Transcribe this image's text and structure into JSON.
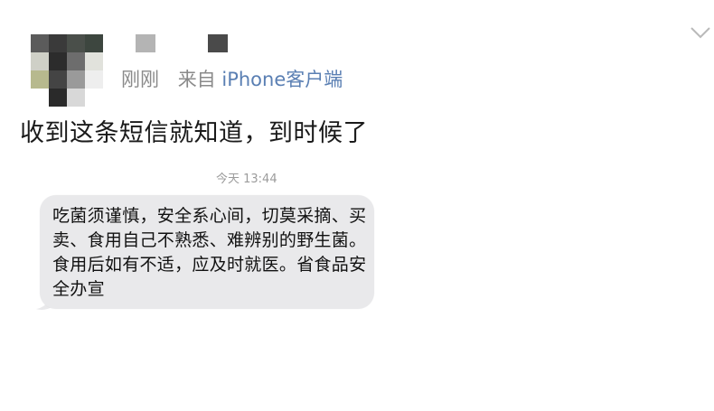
{
  "post": {
    "time": "刚刚",
    "source_prefix": "来自",
    "source": "iPhone客户端",
    "text": "收到这条短信就知道，到时候了"
  },
  "sms": {
    "timestamp": "今天 13:44",
    "message": "吃菌须谨慎，安全系心间，切莫采摘、买卖、食用自己不熟悉、难辨别的野生菌。食用后如有不适，应及时就医。省食品安全办宣"
  },
  "icons": {
    "more": "chevron-down-icon"
  },
  "colors": {
    "meta_gray": "#8a8a8a",
    "link_blue": "#5a7fb3",
    "bubble_gray": "#e9e9eb"
  }
}
